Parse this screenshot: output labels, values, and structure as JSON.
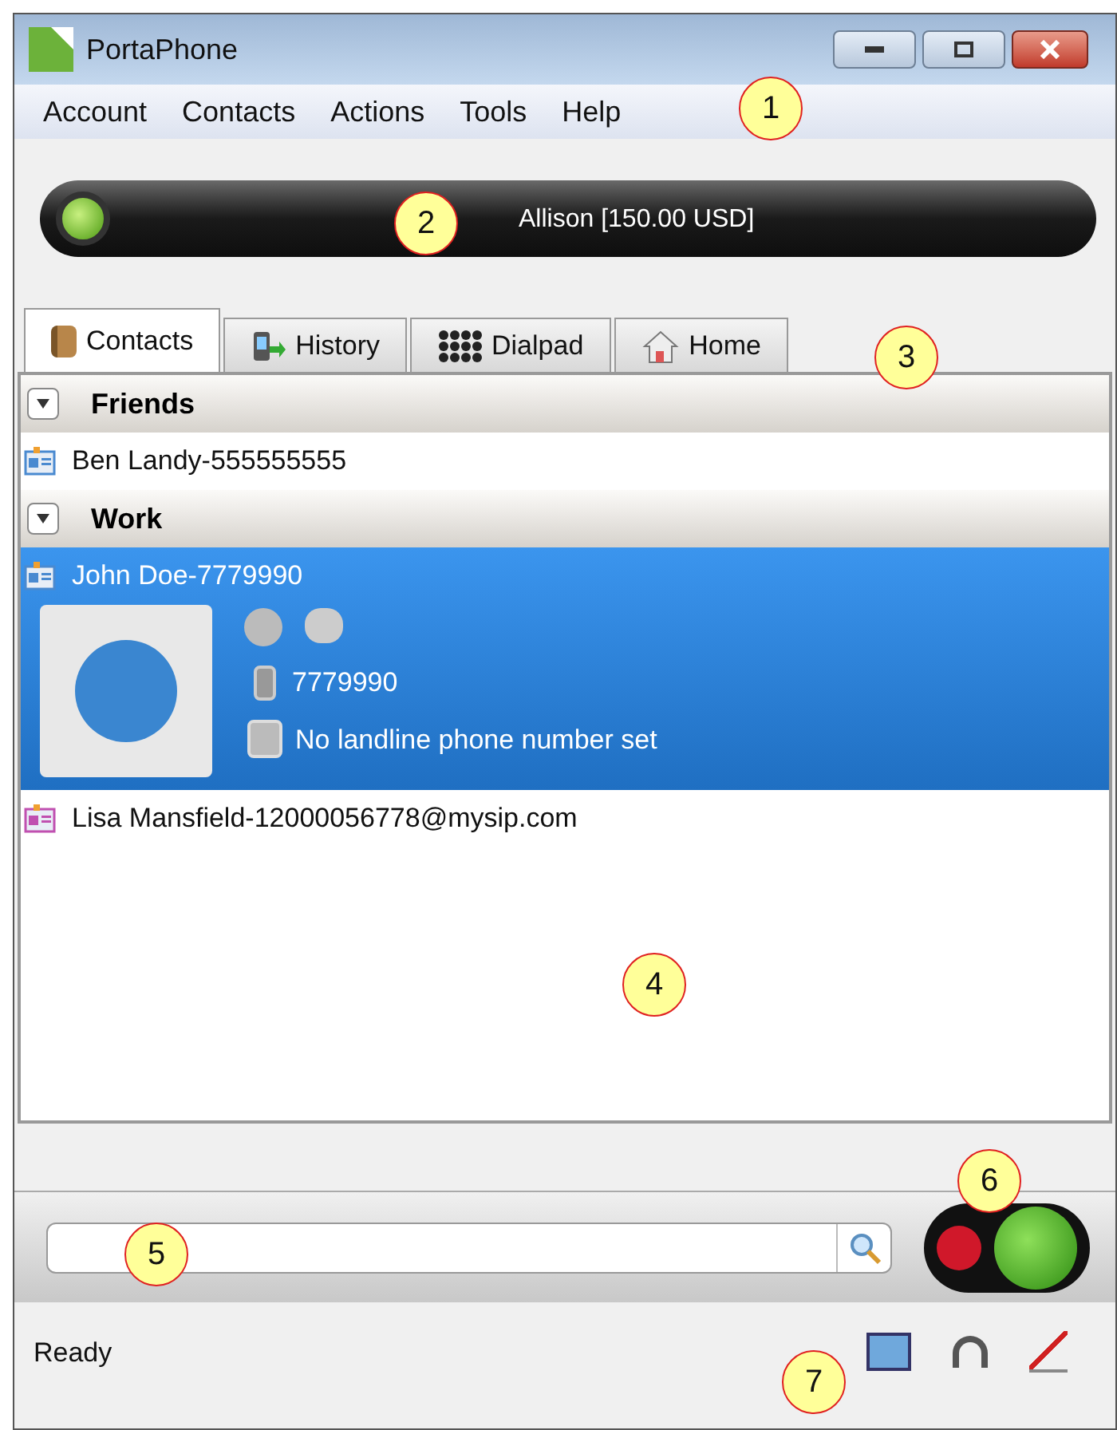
{
  "window": {
    "title": "PortaPhone"
  },
  "menu": [
    "Account",
    "Contacts",
    "Actions",
    "Tools",
    "Help"
  ],
  "account_bar": {
    "online": true,
    "text": "Allison [150.00 USD]"
  },
  "tabs": [
    {
      "label": "Contacts",
      "selected": true
    },
    {
      "label": "History",
      "selected": false
    },
    {
      "label": "Dialpad",
      "selected": false
    },
    {
      "label": "Home",
      "selected": false
    }
  ],
  "groups": [
    {
      "name": "Friends",
      "expanded": true,
      "contacts": [
        {
          "label": "Ben Landy-555555555",
          "selected": false,
          "color": "#4a8ad0"
        }
      ]
    },
    {
      "name": "Work",
      "expanded": true,
      "contacts": [
        {
          "label": "John Doe-7779990",
          "selected": true,
          "color": "#4a8ad0",
          "mobile": "7779990",
          "landline": "No landline phone number set"
        },
        {
          "label": "Lisa Mansfield-12000056778@mysip.com",
          "selected": false,
          "color": "#c050b0"
        }
      ]
    }
  ],
  "status_bar": {
    "text": "Ready"
  },
  "callouts": [
    "1",
    "2",
    "3",
    "4",
    "5",
    "6",
    "7"
  ]
}
